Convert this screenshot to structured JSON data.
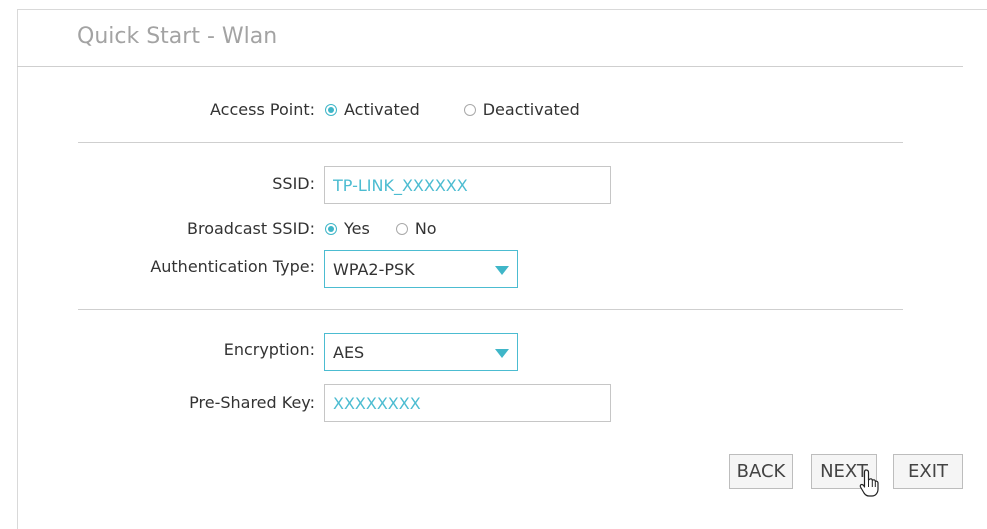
{
  "page": {
    "title": "Quick Start - Wlan"
  },
  "access_point": {
    "label": "Access Point:",
    "options": [
      "Activated",
      "Deactivated"
    ],
    "selected": "Activated"
  },
  "ssid": {
    "label": "SSID:",
    "value": "TP-LINK_XXXXXX"
  },
  "broadcast_ssid": {
    "label": "Broadcast SSID:",
    "options": [
      "Yes",
      "No"
    ],
    "selected": "Yes"
  },
  "authentication_type": {
    "label": "Authentication Type:",
    "value": "WPA2-PSK"
  },
  "encryption": {
    "label": "Encryption:",
    "value": "AES"
  },
  "pre_shared_key": {
    "label": "Pre-Shared Key:",
    "value": "XXXXXXXX"
  },
  "buttons": {
    "back": "BACK",
    "next": "NEXT",
    "exit": "EXIT"
  },
  "colors": {
    "accent": "#3fb6c8",
    "title": "#a3a3a3"
  }
}
